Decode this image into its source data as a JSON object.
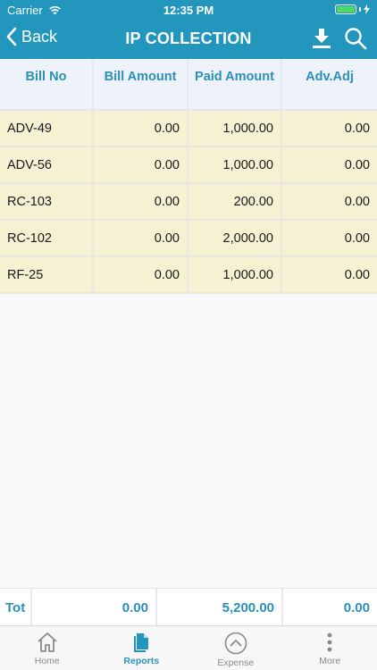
{
  "status_bar": {
    "carrier": "Carrier",
    "time": "12:35 PM",
    "battery_level": 1.0
  },
  "nav": {
    "back_label": "Back",
    "title": "IP COLLECTION",
    "icons": [
      "download-icon",
      "search-icon"
    ]
  },
  "table": {
    "headers": [
      "Bill No",
      "Bill Amount",
      "Paid Amount",
      "Adv.Adj"
    ],
    "rows": [
      [
        "ADV-49",
        "0.00",
        "1,000.00",
        "0.00"
      ],
      [
        "ADV-56",
        "0.00",
        "1,000.00",
        "0.00"
      ],
      [
        "RC-103",
        "0.00",
        "200.00",
        "0.00"
      ],
      [
        "RC-102",
        "0.00",
        "2,000.00",
        "0.00"
      ],
      [
        "RF-25",
        "0.00",
        "1,000.00",
        "0.00"
      ]
    ]
  },
  "totals": {
    "label": "Tot",
    "bill_amount": "0.00",
    "paid_amount": "5,200.00",
    "adv_adj": "0.00"
  },
  "tab_bar": {
    "items": [
      {
        "label": "Home",
        "icon": "home-icon"
      },
      {
        "label": "Reports",
        "icon": "reports-icon"
      },
      {
        "label": "Expense",
        "icon": "expense-icon"
      },
      {
        "label": "More",
        "icon": "more-icon"
      }
    ],
    "active": "Reports"
  },
  "colors": {
    "accent": "#2396bd",
    "row_bg": "#f6f1d3",
    "header_bg": "#eef3fb",
    "header_text": "#2b8fb6"
  }
}
